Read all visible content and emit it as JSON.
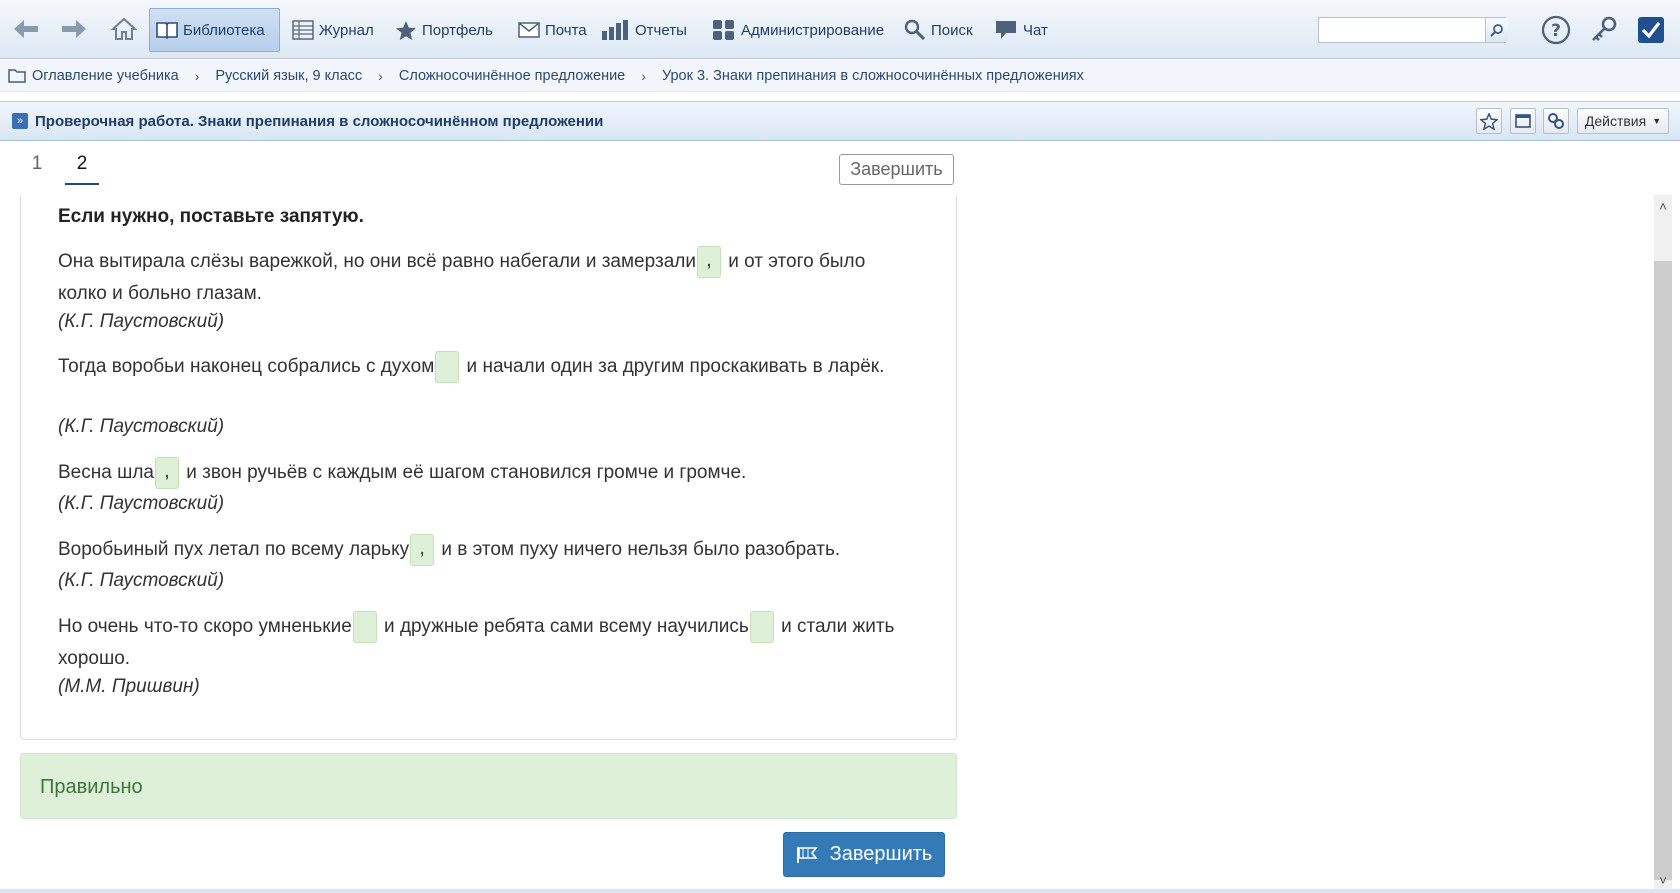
{
  "toolbar": {
    "menu": [
      {
        "label": "Библиотека",
        "icon": "book-icon",
        "active": true
      },
      {
        "label": "Журнал",
        "icon": "journal-icon"
      },
      {
        "label": "Портфель",
        "icon": "star-icon"
      },
      {
        "label": "Почта",
        "icon": "mail-icon"
      },
      {
        "label": "Отчеты",
        "icon": "chart-icon"
      },
      {
        "label": "Администрирование",
        "icon": "users-icon"
      },
      {
        "label": "Поиск",
        "icon": "search-icon"
      },
      {
        "label": "Чат",
        "icon": "chat-icon"
      }
    ],
    "search_value": "",
    "colors": {
      "menu_text": "#1f3f6a",
      "accent": "#337ab7"
    }
  },
  "breadcrumb": [
    "Оглавление учебника",
    "Русский язык, 9 класс",
    "Сложносочинённое предложение",
    "Урок 3. Знаки препинания в сложносочинённых предложениях"
  ],
  "titlebar": {
    "title": "Проверочная работа. Знаки препинания в сложносочинённом предложении",
    "actions_label": "Действия"
  },
  "tabs": [
    {
      "label": "1",
      "active": false
    },
    {
      "label": "2",
      "active": true
    }
  ],
  "finish_label": "Завершить",
  "instruction": "Если нужно, поставьте запятую.",
  "sentences": [
    {
      "before": "Она вытирала слёзы варежкой, но они всё равно набегали и замерзали",
      "blank": ",",
      "after": " и от этого было колко и больно глазам.",
      "author": "(К.Г. Паустовский)"
    },
    {
      "before": "Тогда воробьи наконец собрались с духом",
      "blank": "",
      "after": " и начали один за другим проскакивать в ларёк.",
      "author": "(К.Г. Паустовский)"
    },
    {
      "before": "Весна шла",
      "blank": ",",
      "after": " и звон ручьёв с каждым её шагом становился громче и громче.",
      "author": "(К.Г. Паустовский)"
    },
    {
      "before": "Воробьиный пух летал по всему ларьку",
      "blank": ",",
      "after": " и в этом пуху ничего нельзя было разобрать.",
      "author": "(К.Г. Паустовский)"
    },
    {
      "before": "Но очень что-то скоро умненькие",
      "blank": "",
      "middle": " и дружные ребята сами всему научились",
      "blank2": "",
      "after": " и стали жить хорошо.",
      "author": "(М.М. Пришвин)"
    }
  ],
  "result": {
    "label": "Правильно",
    "color": "#3c763d"
  }
}
